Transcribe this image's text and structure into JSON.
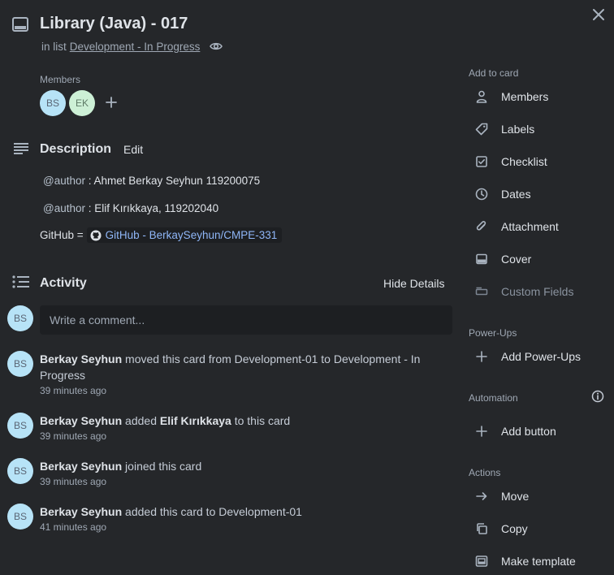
{
  "card": {
    "title": "Library (Java) - 017",
    "in_list_prefix": "in list",
    "list_name": "Development - In Progress"
  },
  "members": {
    "label": "Members",
    "avatars": [
      {
        "initials": "BS",
        "color": "#b7e3f7"
      },
      {
        "initials": "EK",
        "color": "#cdf0d6"
      }
    ]
  },
  "description": {
    "heading": "Description",
    "edit_label": "Edit",
    "lines": [
      {
        "mention": "@author",
        "text": " : Ahmet Berkay Seyhun 119200075"
      },
      {
        "mention": "@author",
        "text": " : Elif Kırıkkaya, 119202040"
      }
    ],
    "github_prefix": "GitHub =",
    "github_link": "GitHub - BerkaySeyhun/CMPE-331"
  },
  "activity": {
    "heading": "Activity",
    "hide_details_label": "Hide Details",
    "comment_placeholder": "Write a comment...",
    "current_user_initials": "BS",
    "items": [
      {
        "initials": "BS",
        "user": "Berkay Seyhun",
        "action": " moved this card from Development-01 to Development - In Progress",
        "time": "39 minutes ago"
      },
      {
        "initials": "BS",
        "user": "Berkay Seyhun",
        "action_pre": " added ",
        "target": "Elif Kırıkkaya",
        "action_post": " to this card",
        "time": "39 minutes ago"
      },
      {
        "initials": "BS",
        "user": "Berkay Seyhun",
        "action": " joined this card",
        "time": "39 minutes ago"
      },
      {
        "initials": "BS",
        "user": "Berkay Seyhun",
        "action": " added this card to Development-01",
        "time": "41 minutes ago"
      }
    ]
  },
  "sidebar": {
    "add_to_card": {
      "heading": "Add to card",
      "items": [
        {
          "label": "Members",
          "icon": "person-icon"
        },
        {
          "label": "Labels",
          "icon": "tag-icon"
        },
        {
          "label": "Checklist",
          "icon": "checkbox-icon"
        },
        {
          "label": "Dates",
          "icon": "clock-icon"
        },
        {
          "label": "Attachment",
          "icon": "paperclip-icon"
        },
        {
          "label": "Cover",
          "icon": "cover-icon"
        },
        {
          "label": "Custom Fields",
          "icon": "custom-fields-icon"
        }
      ]
    },
    "power_ups": {
      "heading": "Power-Ups",
      "items": [
        {
          "label": "Add Power-Ups",
          "icon": "plus-icon"
        }
      ]
    },
    "automation": {
      "heading": "Automation",
      "items": [
        {
          "label": "Add button",
          "icon": "plus-icon"
        }
      ]
    },
    "actions": {
      "heading": "Actions",
      "items": [
        {
          "label": "Move",
          "icon": "arrow-right-icon"
        },
        {
          "label": "Copy",
          "icon": "copy-icon"
        },
        {
          "label": "Make template",
          "icon": "template-icon"
        }
      ]
    }
  },
  "colors": {
    "background": "#25272a",
    "input_background": "#1d1f22",
    "link_blue": "#8fb6f7",
    "avatar_bs": "#b7e3f7",
    "avatar_ek": "#cdf0d6"
  }
}
